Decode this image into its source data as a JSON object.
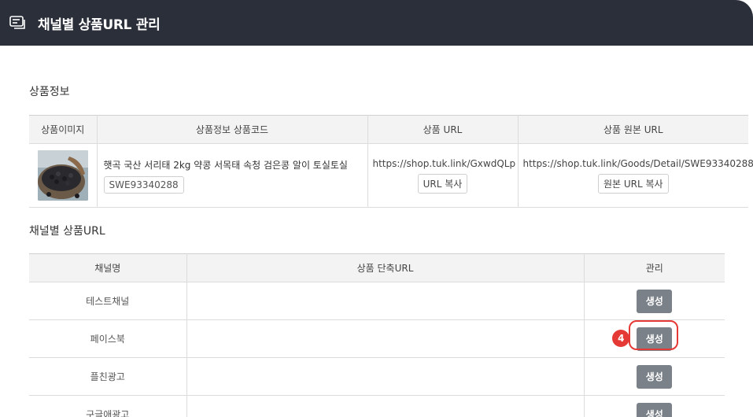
{
  "window": {
    "icon": "window-list-icon",
    "title": "채널별 상품URL 관리"
  },
  "product_section": {
    "title": "상품정보",
    "headers": [
      "상품이미지",
      "상품정보 상품코드",
      "상품 URL",
      "상품 원본 URL"
    ],
    "product": {
      "image_icon": "black-beans-photo",
      "name": "햇곡 국산 서리태 2kg 약콩 서목태 속청 검은콩 알이 토실토실",
      "code": "SWE93340288",
      "url": "https://shop.tuk.link/GxwdQLp",
      "url_copy_label": "URL 복사",
      "original_url": "https://shop.tuk.link/Goods/Detail/SWE93340288",
      "original_copy_label": "원본 URL 복사"
    }
  },
  "channel_section": {
    "title": "채널별 상품URL",
    "headers": [
      "채널명",
      "상품 단축URL",
      "관리"
    ],
    "rows": [
      {
        "channel": "테스트채널",
        "short_url": "",
        "action": "생성"
      },
      {
        "channel": "페이스북",
        "short_url": "",
        "action": "생성"
      },
      {
        "channel": "플친광고",
        "short_url": "",
        "action": "생성"
      },
      {
        "channel": "구글애광고",
        "short_url": "",
        "action": "생성"
      }
    ],
    "step_badge": "4"
  },
  "colors": {
    "titlebar": "#2b2f3a",
    "button": "#7a8189",
    "highlight": "#e53935"
  }
}
